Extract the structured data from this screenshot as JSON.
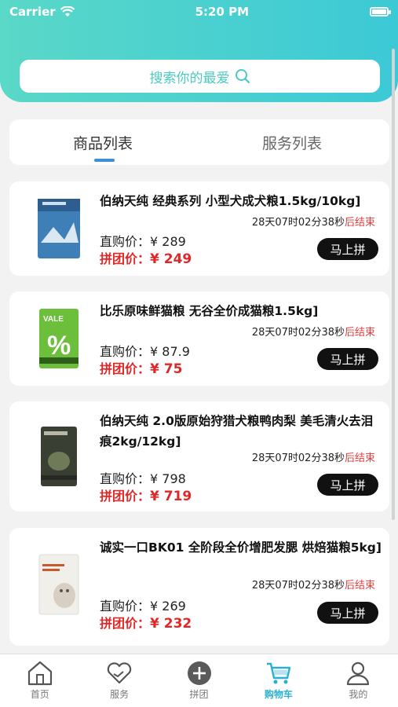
{
  "status_bar": {
    "carrier": "Carrier",
    "time": "5:20 PM"
  },
  "search": {
    "placeholder": "搜索你的最爱"
  },
  "tabs": [
    {
      "label": "商品列表",
      "active": true
    },
    {
      "label": "服务列表",
      "active": false
    }
  ],
  "products": [
    {
      "title": "伯纳天纯 经典系列 小型犬成犬粮1.5kg/10kg]",
      "countdown": "28天07时02分38秒",
      "countdown_suffix": "后结束",
      "direct_label": "直购价：",
      "direct_price": "¥ 289",
      "group_label": "拼团价：",
      "group_price": "¥ 249",
      "button": "马上拼",
      "pack_color": "#3e7fb8"
    },
    {
      "title": "比乐原味鲜猫粮 无谷全价成猫粮1.5kg]",
      "countdown": "28天07时02分38秒",
      "countdown_suffix": "后结束",
      "direct_label": "直购价：",
      "direct_price": "¥ 87.9",
      "group_label": "拼团价：",
      "group_price": "¥ 75",
      "button": "马上拼",
      "pack_color": "#6bbf3a"
    },
    {
      "title": "伯纳天纯 2.0版原始狩猎犬粮鸭肉梨 美毛清火去泪痕2kg/12kg]",
      "countdown": "28天07时02分38秒",
      "countdown_suffix": "后结束",
      "direct_label": "直购价：",
      "direct_price": "¥ 798",
      "group_label": "拼团价：",
      "group_price": "¥ 719",
      "button": "马上拼",
      "pack_color": "#3a3f33"
    },
    {
      "title": "诚实一口BK01 全阶段全价增肥发腮 烘焙猫粮5kg]",
      "countdown": "28天07时02分38秒",
      "countdown_suffix": "后结束",
      "direct_label": "直购价：",
      "direct_price": "¥ 269",
      "group_label": "拼团价：",
      "group_price": "¥ 232",
      "button": "马上拼",
      "pack_color": "#f1efe9"
    }
  ],
  "tabbar": [
    {
      "label": "首页",
      "icon": "home-icon"
    },
    {
      "label": "服务",
      "icon": "heart-hand-icon"
    },
    {
      "label": "拼团",
      "icon": "plus-circle-icon"
    },
    {
      "label": "购物车",
      "icon": "cart-icon",
      "active": true
    },
    {
      "label": "我的",
      "icon": "user-icon"
    }
  ],
  "colors": {
    "accent": "#3cc9d6",
    "price_red": "#e02727",
    "active_tab": "#2ab0d0"
  }
}
